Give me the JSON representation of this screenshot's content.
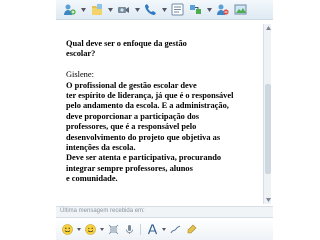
{
  "toolbar": {
    "icons": [
      "invite-contact-icon",
      "send-files-icon",
      "video-call-icon",
      "voice-call-icon",
      "activities-icon",
      "games-icon",
      "block-icon",
      "background-icon"
    ]
  },
  "conversation": {
    "lines": [
      {
        "text": "Qual deve ser o enfoque da gestão",
        "style": "bold"
      },
      {
        "text": "escolar?",
        "style": "bold"
      },
      {
        "text": "",
        "style": "gap"
      },
      {
        "text": "Gislene:",
        "style": "plain"
      },
      {
        "text": "O profissional de gestão escolar deve",
        "style": "bold"
      },
      {
        "text": "ter espírito de liderança, já que é o responsável",
        "style": "bold"
      },
      {
        "text": "pelo andamento da escola. E a administração,",
        "style": "bold"
      },
      {
        "text": "deve proporcionar a participação dos",
        "style": "bold"
      },
      {
        "text": "professores, que é a responsável pelo",
        "style": "bold"
      },
      {
        "text": "desenvolvimento do projeto que objetiva as",
        "style": "bold"
      },
      {
        "text": "intenções da escola.",
        "style": "bold"
      },
      {
        "text": " Deve ser atenta e participativa, procurando",
        "style": "bold"
      },
      {
        "text": " integrar sempre professores, alunos",
        "style": "bold"
      },
      {
        "text": "e comunidade.",
        "style": "bold"
      }
    ]
  },
  "status": {
    "last_message": "Última mensagem recebida em:"
  },
  "format_bar": {
    "icons": [
      "emoticon-icon",
      "wink-icon",
      "nudge-icon",
      "voice-clip-icon",
      "font-icon",
      "handwriting-icon",
      "ink-icon"
    ]
  },
  "colors": {
    "toolbar_top": "#f3f8fc",
    "toolbar_bottom": "#dfeaf3",
    "status_text": "#8a96a0",
    "text": "#000000"
  }
}
